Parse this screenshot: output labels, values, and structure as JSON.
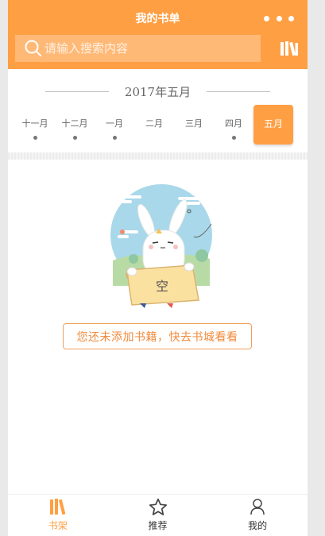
{
  "header": {
    "title": "我的书单",
    "more_icon": "more-dots-icon",
    "search_placeholder": "请输入搜索内容",
    "search_value": "",
    "shelf_icon": "books-icon",
    "brand_color": "#ff9f43"
  },
  "month_picker": {
    "title": "2017年五月",
    "tabs": [
      {
        "label": "十一月",
        "has_books": true
      },
      {
        "label": "十二月",
        "has_books": true
      },
      {
        "label": "一月",
        "has_books": true
      },
      {
        "label": "二月",
        "has_books": false
      },
      {
        "label": "三月",
        "has_books": false
      },
      {
        "label": "四月",
        "has_books": true
      },
      {
        "label": "五月",
        "has_books": false,
        "selected": true
      }
    ]
  },
  "empty_state": {
    "sign_text": "空",
    "action_label": "您还未添加书籍，快去书城看看"
  },
  "tabbar": {
    "items": [
      {
        "label": "书架",
        "icon": "bookshelf-icon",
        "active": true
      },
      {
        "label": "推荐",
        "icon": "star-icon",
        "active": false
      },
      {
        "label": "我的",
        "icon": "user-icon",
        "active": false
      }
    ],
    "active_color": "#ff9f43"
  }
}
